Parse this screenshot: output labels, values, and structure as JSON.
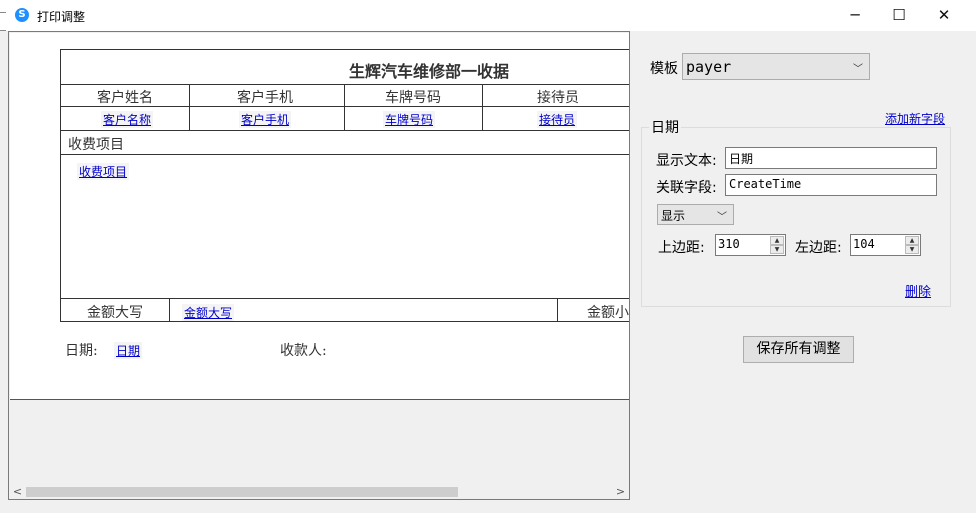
{
  "window": {
    "title": "打印调整",
    "icon": "skype-style-app-icon",
    "controls": {
      "minimize": "─",
      "maximize": "☐",
      "close": "✕"
    }
  },
  "receipt": {
    "title": "生辉汽车维修部一收据",
    "columns": [
      "客户姓名",
      "客户手机",
      "车牌号码",
      "接待员"
    ],
    "fields": [
      "客户名称",
      "客户手机",
      "车牌号码",
      "接待员"
    ],
    "items_header": "收费项目",
    "items_field": "收费项目",
    "amount_upper_label": "金额大写",
    "amount_upper_field": "金额大写",
    "amount_lower_label": "金额小",
    "date_label": "日期:",
    "date_field": "日期",
    "payee_label": "收款人:"
  },
  "scrollbar": {
    "left_arrow": "<",
    "right_arrow": ">"
  },
  "panel": {
    "template_label": "模板",
    "template_value": "payer",
    "add_field_link": "添加新字段",
    "group_title": "日期",
    "display_text_label": "显示文本:",
    "display_text_value": "日期",
    "linked_field_label": "关联字段:",
    "linked_field_value": "CreateTime",
    "visibility_value": "显示",
    "top_margin_label": "上边距:",
    "top_margin_value": "310",
    "left_margin_label": "左边距:",
    "left_margin_value": "104",
    "delete_link": "删除",
    "save_button": "保存所有调整"
  }
}
